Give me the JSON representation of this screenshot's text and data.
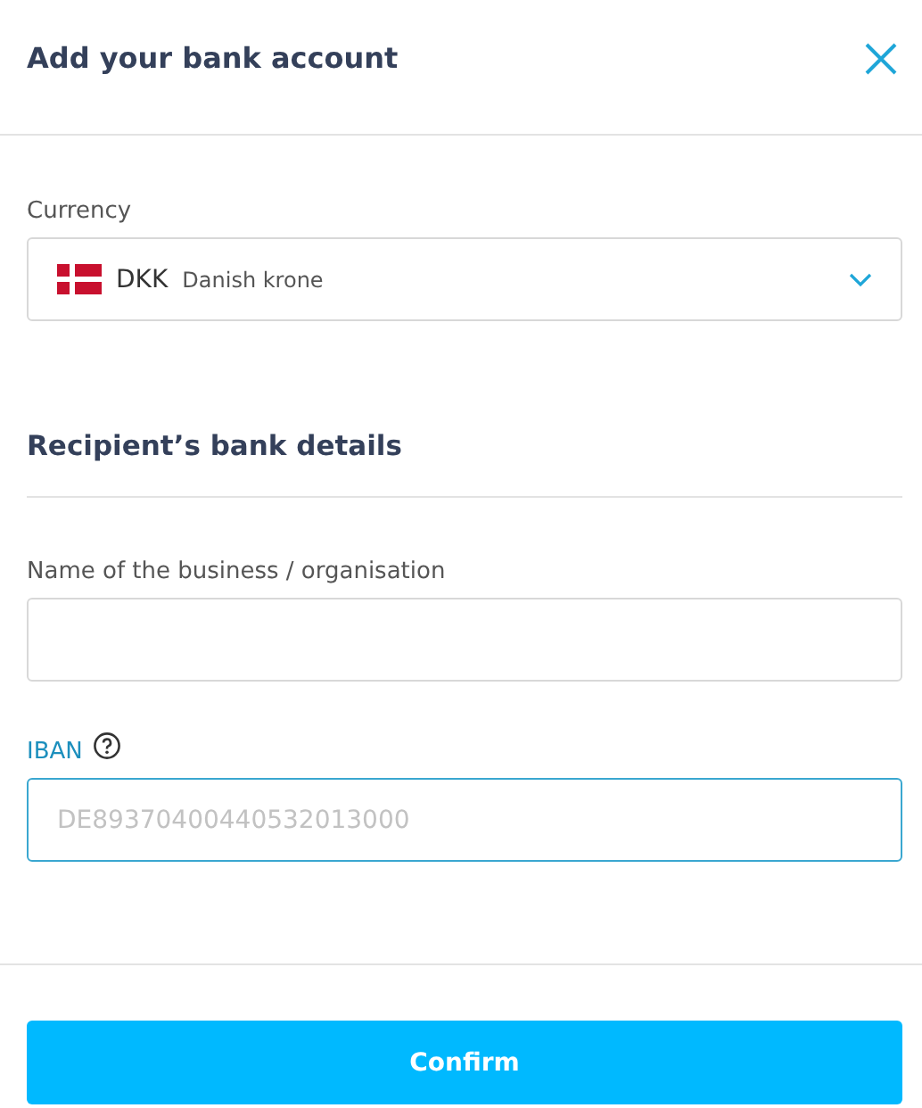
{
  "dialog": {
    "title": "Add your bank account"
  },
  "currency": {
    "label": "Currency",
    "code": "DKK",
    "name": "Danish krone"
  },
  "section": {
    "title": "Recipient’s bank details"
  },
  "fields": [
    {
      "label": "Name of the business / organisation",
      "focused": false,
      "help": false
    },
    {
      "label": "IBAN",
      "placeholder": "DE89370400440532013000",
      "focused": true,
      "help": true
    }
  ],
  "buttons": [
    "Confirm"
  ]
}
